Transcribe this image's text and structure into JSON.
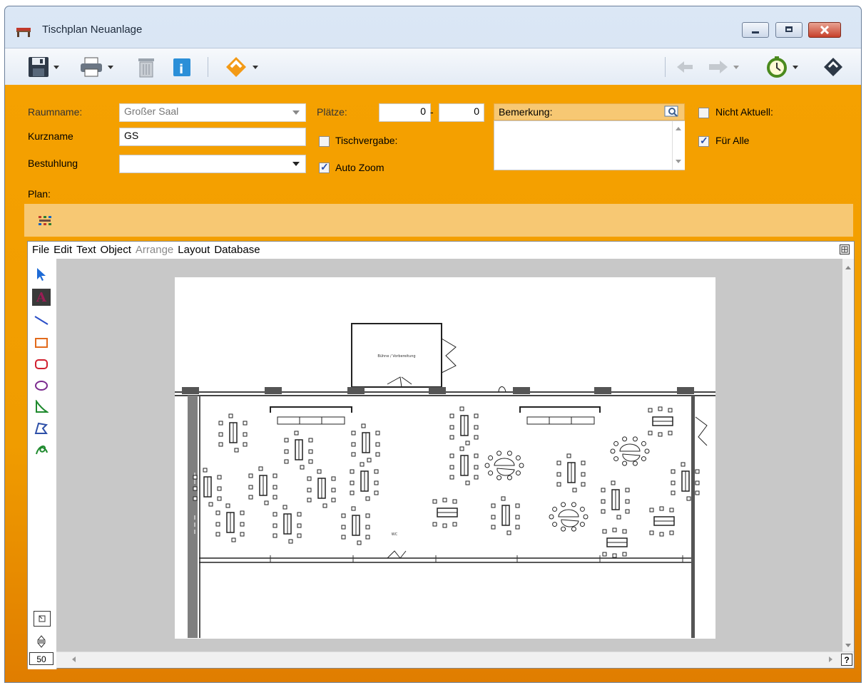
{
  "window": {
    "title": "Tischplan Neuanlage"
  },
  "form": {
    "raumname_label": "Raumname:",
    "raumname_value": "Großer Saal",
    "kurzname_label": "Kurzname",
    "kurzname_value": "GS",
    "bestuhlung_label": "Bestuhlung",
    "bestuhlung_value": "",
    "plaetze_label": "Plätze:",
    "plaetze_from": "0",
    "plaetze_sep": "-",
    "plaetze_to": "0",
    "tischvergabe_label": "Tischvergabe:",
    "tischvergabe_checked": false,
    "autozoom_label": "Auto Zoom",
    "autozoom_checked": true,
    "bemerkung_label": "Bemerkung:",
    "bemerkung_value": "",
    "nicht_aktuell_label": "Nicht Aktuell:",
    "nicht_aktuell_checked": false,
    "fuer_alle_label": "Für Alle",
    "fuer_alle_checked": true,
    "plan_label": "Plan:"
  },
  "editor": {
    "menu": [
      "File",
      "Edit",
      "Text",
      "Object",
      "Arrange",
      "Layout",
      "Database"
    ],
    "disabled_menu": "Arrange",
    "zoom": "50",
    "help": "?",
    "room_label": "Bühne / Vorbereitung",
    "small_label": "WC"
  },
  "colors": {
    "accent_orange": "#f09c00",
    "plan_bar": "#f7c873",
    "close_red": "#c7402a"
  }
}
